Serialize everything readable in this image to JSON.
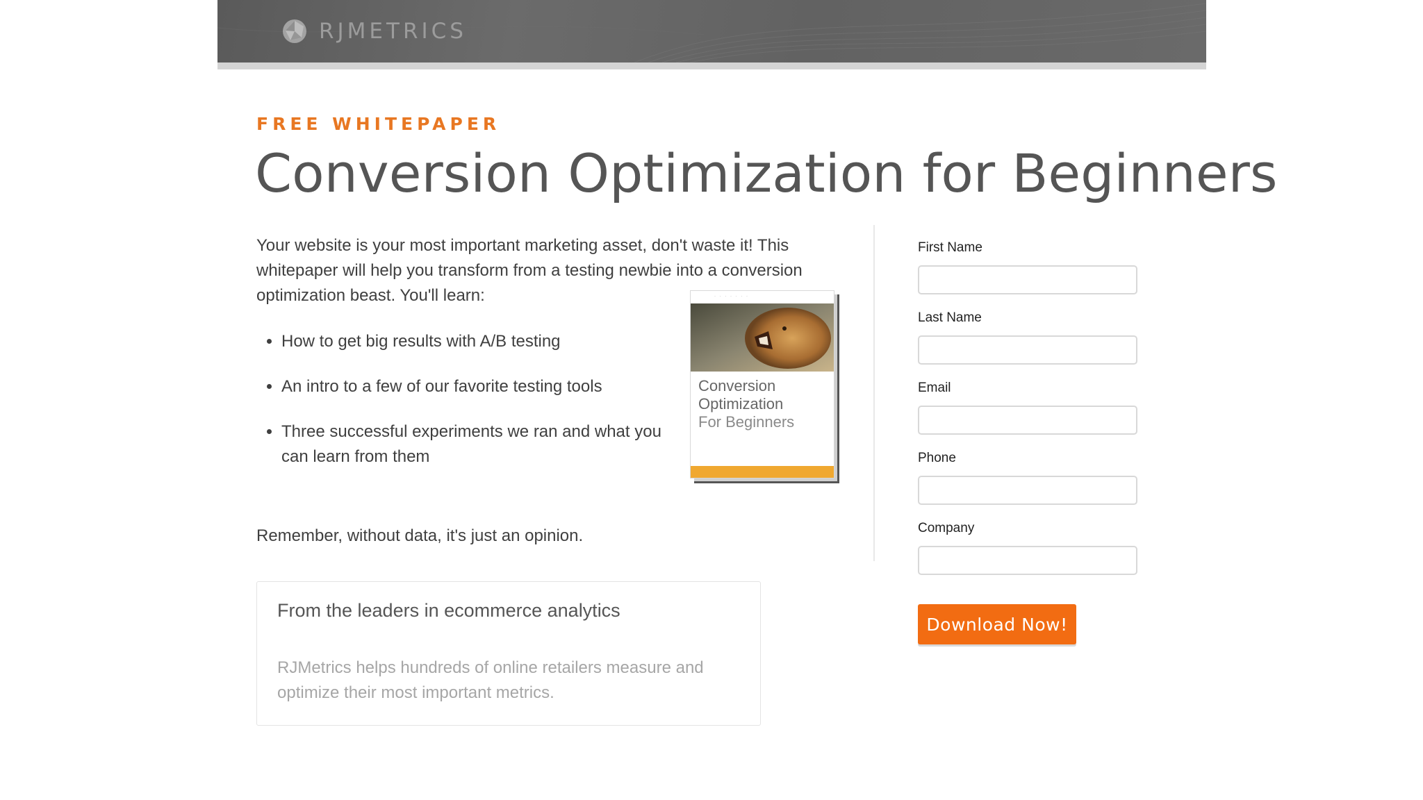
{
  "header": {
    "brand": "RJMETRICS",
    "logo_icon": "rjmetrics-logo-icon"
  },
  "hero": {
    "kicker": "FREE WHITEPAPER",
    "title": "Conversion Optimization for Beginners"
  },
  "content": {
    "intro": "Your website is your most important marketing asset, don't waste it! This whitepaper will help you transform from a testing newbie into a conversion optimization beast. You'll learn:",
    "bullets": [
      "How to get big results with A/B testing",
      "An intro to a few of our favorite testing tools",
      "Three successful experiments we ran and what you can learn from them"
    ],
    "closing": "Remember, without data, it's just an opinion."
  },
  "book": {
    "title_line1": "Conversion",
    "title_line2": "Optimization",
    "title_line3": "For Beginners",
    "stripe_color": "#f0a830"
  },
  "info_box": {
    "heading": "From the leaders in ecommerce analytics",
    "body": "RJMetrics helps hundreds of online retailers measure and optimize their most important metrics."
  },
  "form": {
    "fields": [
      {
        "label": "First Name",
        "value": ""
      },
      {
        "label": "Last Name",
        "value": ""
      },
      {
        "label": "Email",
        "value": ""
      },
      {
        "label": "Phone",
        "value": ""
      },
      {
        "label": "Company",
        "value": ""
      }
    ],
    "submit_label": "Download Now!"
  },
  "colors": {
    "accent_orange": "#e87722",
    "button_orange": "#f26c12",
    "header_gray": "#636363"
  }
}
